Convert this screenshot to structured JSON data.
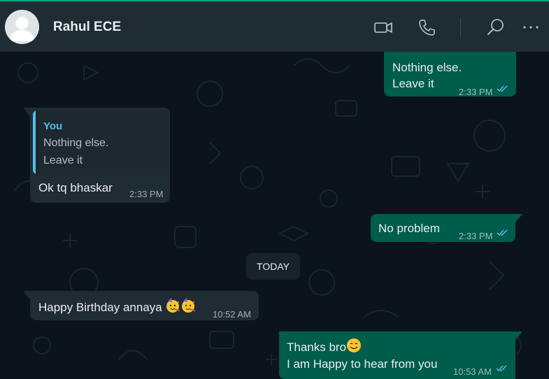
{
  "header": {
    "contact_name": "Rahul ECE",
    "icons": [
      "video-call-icon",
      "voice-call-icon",
      "search-icon",
      "more-options-icon"
    ]
  },
  "colors": {
    "outgoing_bubble": "#005c4b",
    "incoming_bubble": "#202c33",
    "header_bg": "#202c33",
    "chat_bg": "#0b141a",
    "read_ticks": "#53bdeb",
    "accent": "#00a884"
  },
  "messages": [
    {
      "direction": "outgoing",
      "lines": [
        "Nothing else.",
        "Leave it"
      ],
      "time": "2:33 PM",
      "status": "read"
    },
    {
      "direction": "incoming",
      "quoted": {
        "author": "You",
        "lines": [
          "Nothing else.",
          "Leave it"
        ]
      },
      "lines": [
        "Ok tq bhaskar"
      ],
      "time": "2:33 PM"
    },
    {
      "direction": "outgoing",
      "lines": [
        "No problem"
      ],
      "time": "2:33 PM",
      "status": "read"
    },
    {
      "direction": "incoming",
      "lines": [
        "Happy Birthday annaya"
      ],
      "emojis": [
        "party-face-emoji",
        "party-face-emoji"
      ],
      "time": "10:52 AM"
    },
    {
      "direction": "outgoing",
      "lines": [
        "Thanks bro",
        "I am Happy to hear from you"
      ],
      "emojis": [
        "smiling-face-emoji"
      ],
      "time": "10:53 AM",
      "status": "read"
    }
  ],
  "date_separator": "TODAY"
}
